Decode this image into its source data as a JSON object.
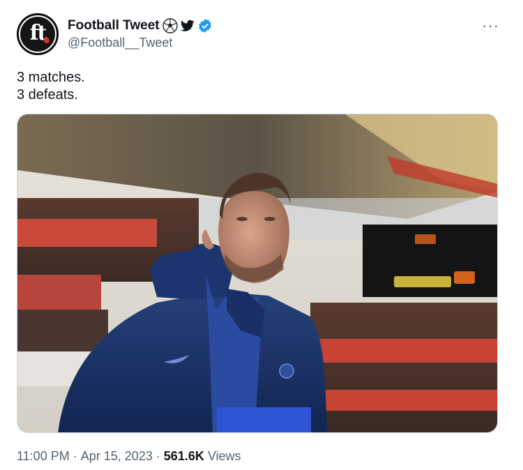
{
  "author": {
    "display_name": "Football Tweet",
    "handle": "@Football__Tweet",
    "avatar_text": "ft",
    "badges": [
      "soccer-ball-icon",
      "twitter-bird-icon",
      "verified-badge-icon"
    ],
    "verified_color": "#1d9bf0"
  },
  "more_label": "···",
  "tweet": {
    "line1": "3 matches.",
    "line2": "3 defeats."
  },
  "meta": {
    "time": "11:00 PM",
    "sep1": "·",
    "date": "Apr 15, 2023",
    "sep2": "·",
    "views_count": "561.6K",
    "views_label": "Views"
  }
}
